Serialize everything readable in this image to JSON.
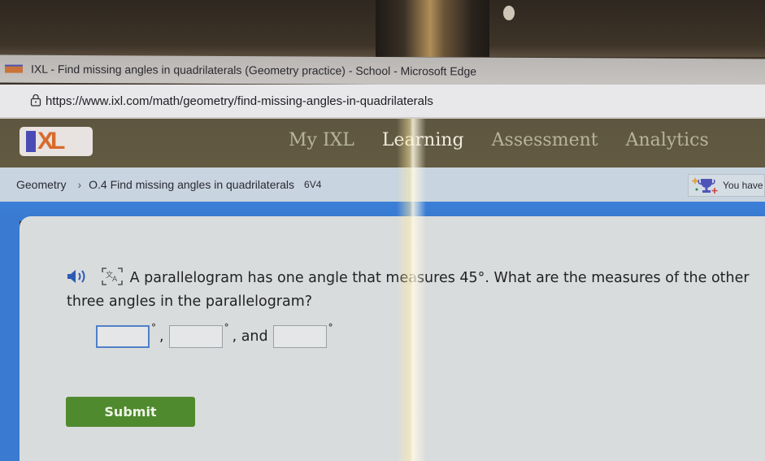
{
  "browser": {
    "window_title": "IXL - Find missing angles in quadrilaterals (Geometry practice) - School - Microsoft Edge",
    "url": "https://www.ixl.com/math/geometry/find-missing-angles-in-quadrilaterals"
  },
  "header": {
    "logo_text": "XL",
    "nav": [
      {
        "label": "My IXL",
        "active": false
      },
      {
        "label": "Learning",
        "active": true
      },
      {
        "label": "Assessment",
        "active": false
      },
      {
        "label": "Analytics",
        "active": false
      }
    ]
  },
  "breadcrumb": {
    "subject": "Geometry",
    "skill": "O.4 Find missing angles in quadrilaterals",
    "code": "6V4"
  },
  "award": {
    "icon": "trophy-icon",
    "text": "You have"
  },
  "question": {
    "line": "A parallelogram has one angle that measures 45°. What are the measures of the other three angles in the parallelogram?",
    "speaker_icon": "speaker-icon",
    "translate_icon": "translate-icon"
  },
  "answers": {
    "inputs": [
      {
        "value": "",
        "placeholder": ""
      },
      {
        "value": "",
        "placeholder": ""
      },
      {
        "value": "",
        "placeholder": ""
      }
    ],
    "degree_symbol": "°",
    "separator": ",",
    "and_label": ", and"
  },
  "submit_label": "Submit",
  "colors": {
    "nav_bg": "#625a41",
    "accent_blue": "#3a7ad1",
    "submit_green": "#4f8a2e",
    "logo_orange": "#d86a2b",
    "logo_purple": "#4a4ab5"
  }
}
